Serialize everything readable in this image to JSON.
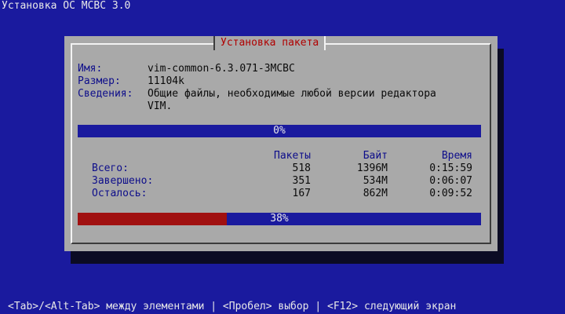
{
  "screen": {
    "title": "Установка ОС МСВС 3.0",
    "help": "<Tab>/<Alt-Tab> между элементами | <Пробел> выбор | <F12> следующий экран"
  },
  "dialog": {
    "title": "Установка пакета",
    "package": {
      "name_label": "Имя:",
      "name_value": "vim-common-6.3.071-3МСВС",
      "size_label": "Размер:",
      "size_value": "11104k",
      "info_label": "Сведения:",
      "info_line1": "Общие файлы, необходимые любой версии редактора",
      "info_line2": "VIM."
    },
    "package_progress": {
      "text": "0%",
      "fraction": 0.0
    },
    "stats": {
      "headers": [
        "Пакеты",
        "Байт",
        "Время"
      ],
      "rows": [
        {
          "label": "Всего:",
          "packages": "518",
          "bytes": "1396M",
          "time": "0:15:59"
        },
        {
          "label": "Завершено:",
          "packages": "351",
          "bytes": "534M",
          "time": "0:06:07"
        },
        {
          "label": "Осталось:",
          "packages": "167",
          "bytes": "862M",
          "time": "0:09:52"
        }
      ]
    },
    "total_progress": {
      "text": "38%",
      "fraction": 0.37
    }
  },
  "colors": {
    "background": "#1a1a9e",
    "dialog": "#a9a9a9",
    "title_text": "#b00000",
    "progress_fill": "#a01010"
  }
}
